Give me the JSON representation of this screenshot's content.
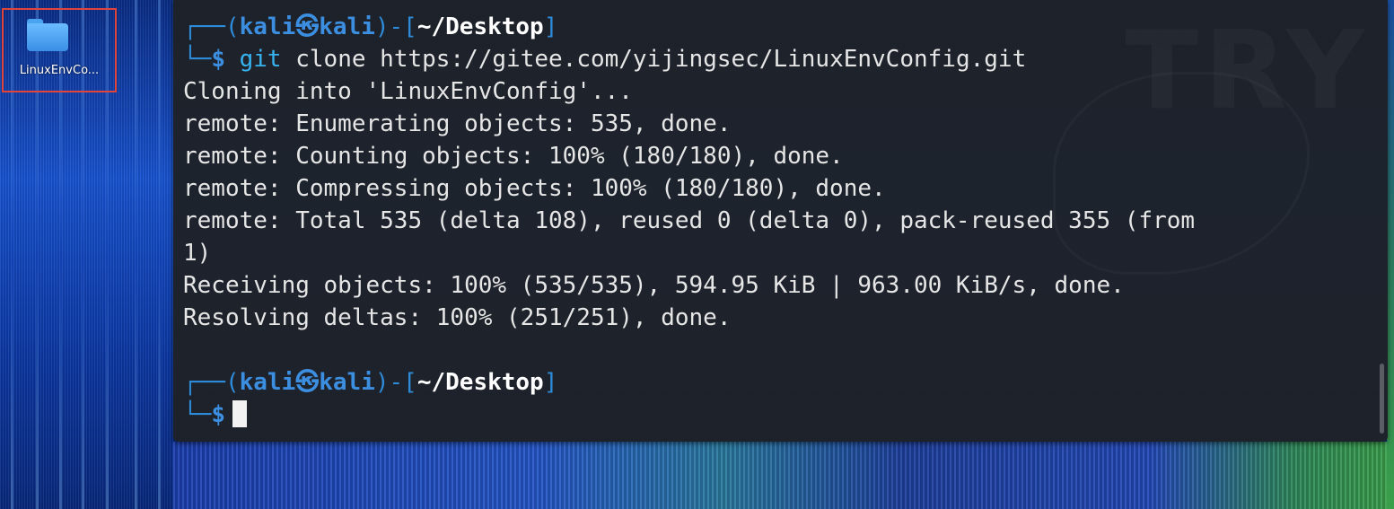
{
  "desktop": {
    "folder_icon": "folder-icon",
    "folder_label": "LinuxEnvCo...",
    "selection_color": "#e0443a"
  },
  "terminal": {
    "prompt1": {
      "box_top": "┌──(",
      "user": "kali㉿kali",
      "sep": ")-[",
      "path": "~/Desktop",
      "close": "]",
      "box_bottom": "└─",
      "dollar": "$",
      "command_git": "git",
      "command_rest": " clone https://gitee.com/yijingsec/LinuxEnvConfig.git"
    },
    "output": [
      "Cloning into 'LinuxEnvConfig'...",
      "remote: Enumerating objects: 535, done.",
      "remote: Counting objects: 100% (180/180), done.",
      "remote: Compressing objects: 100% (180/180), done.",
      "remote: Total 535 (delta 108), reused 0 (delta 0), pack-reused 355 (from",
      "1)",
      "Receiving objects: 100% (535/535), 594.95 KiB | 963.00 KiB/s, done.",
      "Resolving deltas: 100% (251/251), done."
    ],
    "prompt2": {
      "box_top": "┌──(",
      "user": "kali㉿kali",
      "sep": ")-[",
      "path": "~/Desktop",
      "close": "]",
      "box_bottom": "└─",
      "dollar": "$"
    },
    "watermark": "TRY",
    "colors": {
      "background": "#1e2126",
      "prompt_blue": "#3c8fe0",
      "text": "#e6e6e6"
    }
  }
}
